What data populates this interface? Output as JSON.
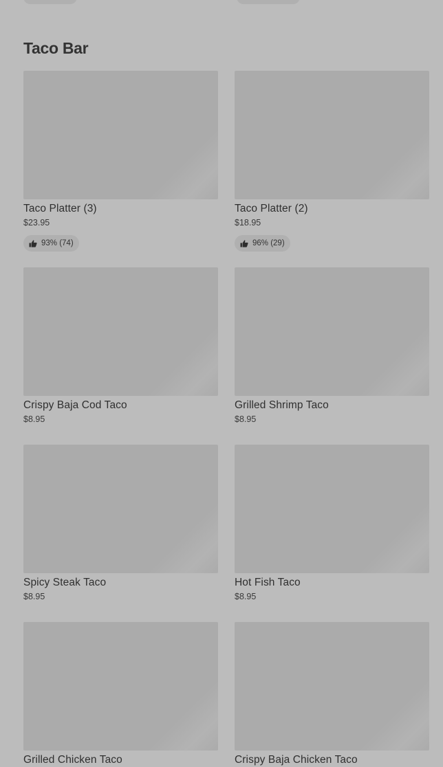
{
  "section": {
    "title": "Taco Bar"
  },
  "items": [
    {
      "name": "Taco Platter (3)",
      "price": "$23.95",
      "rating": "93% (74)"
    },
    {
      "name": "Taco Platter (2)",
      "price": "$18.95",
      "rating": "96% (29)"
    },
    {
      "name": "Crispy Baja Cod Taco",
      "price": "$8.95"
    },
    {
      "name": "Grilled Shrimp Taco",
      "price": "$8.95"
    },
    {
      "name": "Spicy Steak Taco",
      "price": "$8.95"
    },
    {
      "name": "Hot Fish Taco",
      "price": "$8.95"
    },
    {
      "name": "Grilled Chicken Taco",
      "price": ""
    },
    {
      "name": "Crispy Baja Chicken Taco",
      "price": ""
    }
  ],
  "icons": {
    "thumbs_up": "thumbs-up-icon"
  }
}
